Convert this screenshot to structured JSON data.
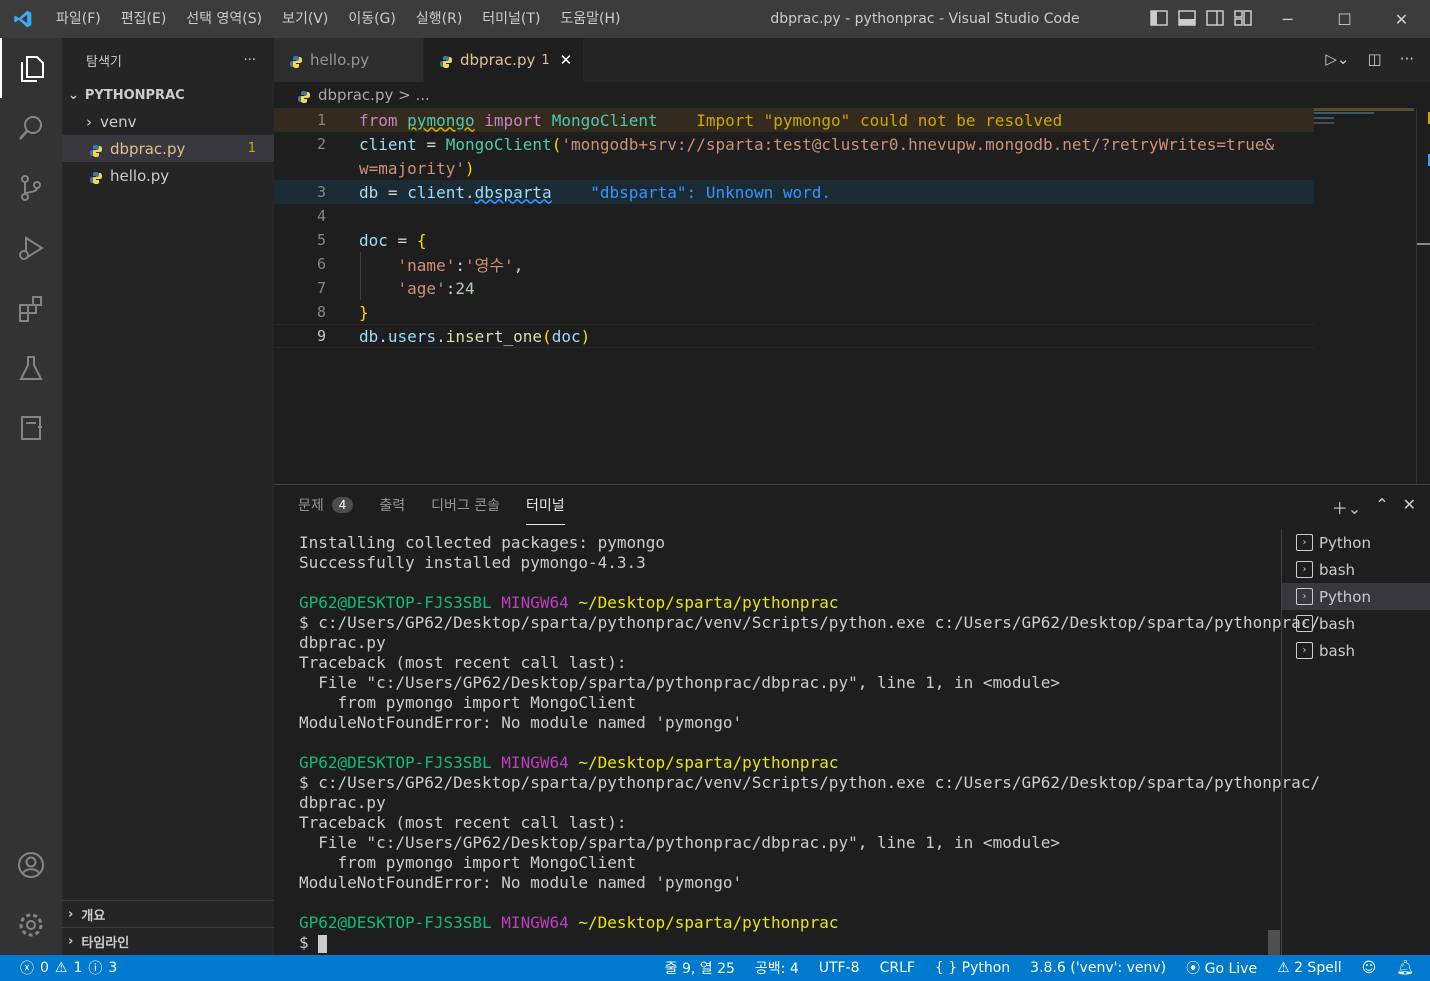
{
  "titlebar": {
    "menus": [
      "파일(F)",
      "편집(E)",
      "선택 영역(S)",
      "보기(V)",
      "이동(G)",
      "실행(R)",
      "터미널(T)",
      "도움말(H)"
    ],
    "title": "dbprac.py - pythonprac - Visual Studio Code",
    "accent": "#007acc"
  },
  "sidebar": {
    "header": "탐색기",
    "more": "···",
    "folder": "PYTHONPRAC",
    "items": [
      {
        "label": "venv",
        "type": "folder"
      },
      {
        "label": "dbprac.py",
        "type": "python",
        "badge": "1"
      },
      {
        "label": "hello.py",
        "type": "python"
      }
    ],
    "outline": "개요",
    "timeline": "타임라인"
  },
  "tabs": [
    {
      "label": "hello.py"
    },
    {
      "label": "dbprac.py",
      "badge": "1",
      "close": "✕"
    }
  ],
  "breadcrumb": {
    "file": "dbprac.py",
    "sep": " > ",
    "rest": "..."
  },
  "editor": {
    "line_numbers": [
      "1",
      "2",
      "",
      "3",
      "4",
      "5",
      "6",
      "7",
      "8",
      "9"
    ],
    "diag1": "Import \"pymongo\" could not be resolved",
    "diag3": "\"dbsparta\": Unknown word.",
    "line2_url": "'mongodb+srv://sparta:test@cluster0.hnevupw.mongodb.net/?retryWrites=true&",
    "line2_cont": "w=majority'",
    "name_val": "'영수'"
  },
  "panel": {
    "tabs": [
      {
        "label": "문제",
        "count": "4"
      },
      {
        "label": "출력"
      },
      {
        "label": "디버그 콘솔"
      },
      {
        "label": "터미널"
      }
    ],
    "terminal_lines": [
      "Installing collected packages: pymongo",
      "Successfully installed pymongo-4.3.3",
      "",
      "$ c:/Users/GP62/Desktop/sparta/pythonprac/venv/Scripts/python.exe c:/Users/GP62/Desktop/sparta/pythonprac/",
      "dbprac.py",
      "Traceback (most recent call last):",
      "  File \"c:/Users/GP62/Desktop/sparta/pythonprac/dbprac.py\", line 1, in <module>",
      "    from pymongo import MongoClient",
      "ModuleNotFoundError: No module named 'pymongo'"
    ],
    "prompt_user": "GP62@DESKTOP-FJS3SBL",
    "prompt_env": "MINGW64",
    "prompt_path": "~/Desktop/sparta/pythonprac",
    "prompt_symbol": "$ ",
    "terminals": [
      "Python",
      "bash",
      "Python",
      "bash",
      "bash"
    ]
  },
  "statusbar": {
    "errors": "0",
    "warnings": "1",
    "infos": "3",
    "position": "줄 9, 열 25",
    "spaces": "공백: 4",
    "encoding": "UTF-8",
    "eol": "CRLF",
    "language": "Python",
    "interpreter": "3.8.6 ('venv': venv)",
    "golive": "Go Live",
    "spell": "2 Spell"
  }
}
